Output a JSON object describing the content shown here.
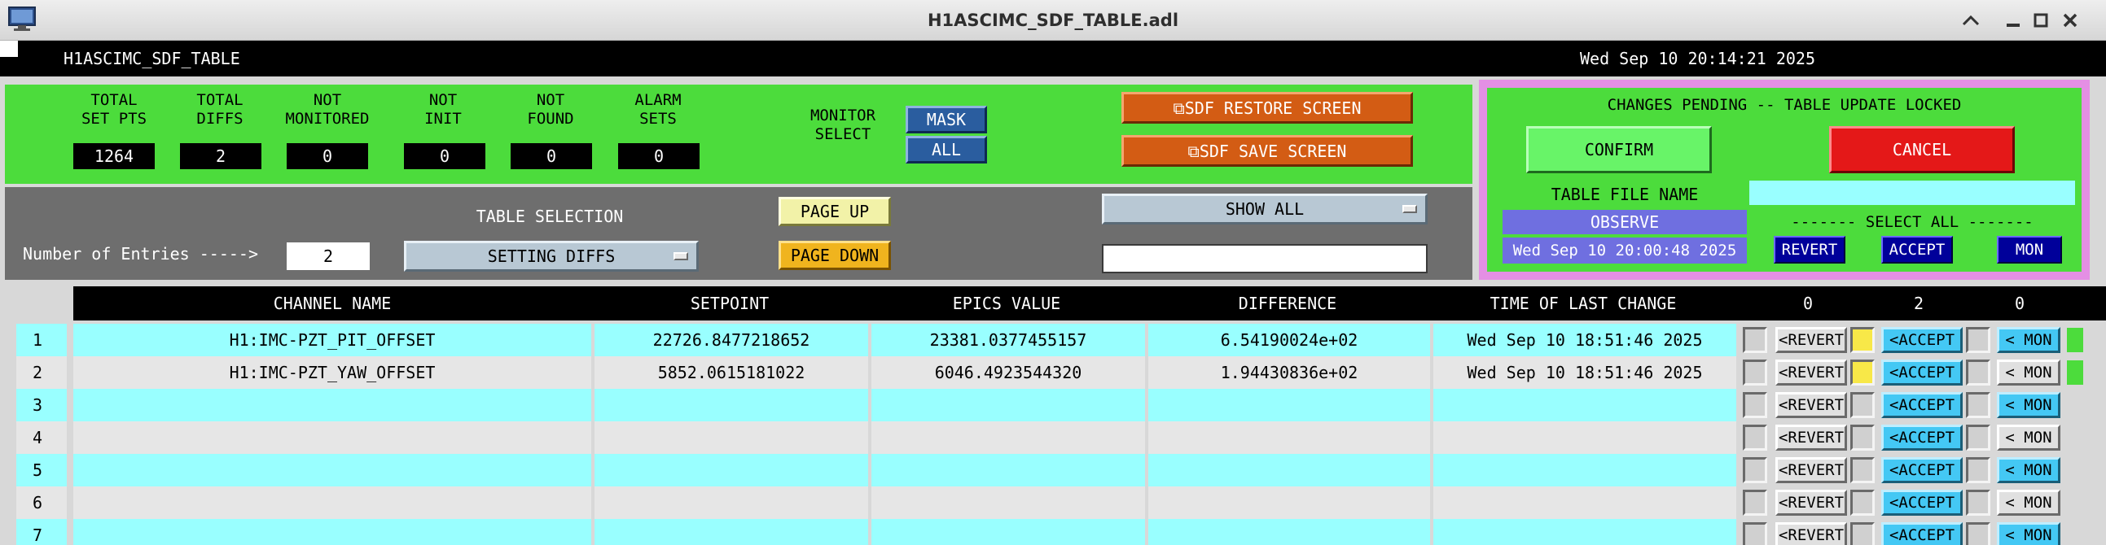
{
  "window": {
    "title": "H1ASCIMC_SDF_TABLE.adl",
    "controls": [
      "chevron-up-icon",
      "minimize-icon",
      "maximize-icon",
      "close-icon"
    ]
  },
  "header": {
    "screen_name": "H1ASCIMC_SDF_TABLE",
    "datetime": "Wed Sep 10 20:14:21 2025"
  },
  "stats": [
    {
      "label_line1": "TOTAL",
      "label_line2": "SET PTS",
      "value": "1264"
    },
    {
      "label_line1": "TOTAL",
      "label_line2": "DIFFS",
      "value": "2"
    },
    {
      "label_line1": "NOT",
      "label_line2": "MONITORED",
      "value": "0"
    },
    {
      "label_line1": "NOT",
      "label_line2": "INIT",
      "value": "0"
    },
    {
      "label_line1": "NOT",
      "label_line2": "FOUND",
      "value": "0"
    },
    {
      "label_line1": "ALARM",
      "label_line2": "SETS",
      "value": "0"
    }
  ],
  "monitor_select": {
    "label_line1": "MONITOR",
    "label_line2": "SELECT",
    "options": [
      "MASK",
      "ALL"
    ]
  },
  "screen_buttons": {
    "restore": "⧉SDF RESTORE SCREEN",
    "save": "⧉SDF SAVE SCREEN"
  },
  "pending": {
    "message": "CHANGES PENDING -- TABLE UPDATE LOCKED",
    "confirm": "CONFIRM",
    "cancel": "CANCEL",
    "table_file_label": "TABLE FILE NAME",
    "table_file_name": "OBSERVE",
    "file_datetime": "Wed Sep 10 20:00:48 2025",
    "select_all_label": "------- SELECT ALL -------",
    "select_all_buttons": [
      "REVERT",
      "ACCEPT",
      "MON"
    ]
  },
  "table_controls": {
    "entries_label": "Number of Entries ----->",
    "entries_value": "2",
    "selection_label": "TABLE SELECTION",
    "selection_value": "SETTING DIFFS",
    "page_up": "PAGE UP",
    "page_down": "PAGE DOWN",
    "filter_value": "SHOW ALL",
    "search_value": ""
  },
  "columns": {
    "channel": "CHANNEL NAME",
    "setpoint": "SETPOINT",
    "epics": "EPICS VALUE",
    "difference": "DIFFERENCE",
    "time": "TIME OF LAST CHANGE",
    "count_revert": "0",
    "count_accept": "2",
    "count_mon": "0"
  },
  "rows": [
    {
      "index": "1",
      "channel": "H1:IMC-PZT_PIT_OFFSET",
      "setpoint": "22726.8477218652",
      "epics": "23381.0377455157",
      "difference": "6.54190024e+02",
      "time": "Wed Sep 10 18:51:46 2025",
      "accept_flag": true,
      "mon_on": true
    },
    {
      "index": "2",
      "channel": "H1:IMC-PZT_YAW_OFFSET",
      "setpoint": "5852.0615181022",
      "epics": "6046.4923544320",
      "difference": "1.94430836e+02",
      "time": "Wed Sep 10 18:51:46 2025",
      "accept_flag": true,
      "mon_on": false
    },
    {
      "index": "3",
      "channel": "",
      "setpoint": "",
      "epics": "",
      "difference": "",
      "time": "",
      "accept_flag": false,
      "mon_on": true
    },
    {
      "index": "4",
      "channel": "",
      "setpoint": "",
      "epics": "",
      "difference": "",
      "time": "",
      "accept_flag": false,
      "mon_on": false
    },
    {
      "index": "5",
      "channel": "",
      "setpoint": "",
      "epics": "",
      "difference": "",
      "time": "",
      "accept_flag": false,
      "mon_on": true
    },
    {
      "index": "6",
      "channel": "",
      "setpoint": "",
      "epics": "",
      "difference": "",
      "time": "",
      "accept_flag": false,
      "mon_on": false
    },
    {
      "index": "7",
      "channel": "",
      "setpoint": "",
      "epics": "",
      "difference": "",
      "time": "",
      "accept_flag": false,
      "mon_on": true
    }
  ],
  "row_buttons": {
    "revert": "<REVERT",
    "accept": "<ACCEPT",
    "mon": "< MON"
  },
  "colors": {
    "panel_green": "#4cdc3c",
    "panel_gray": "#6e6e6e",
    "row_cyan": "#99ffff",
    "row_gray": "#e6e6e6",
    "pending_border": "#e48fe4"
  }
}
